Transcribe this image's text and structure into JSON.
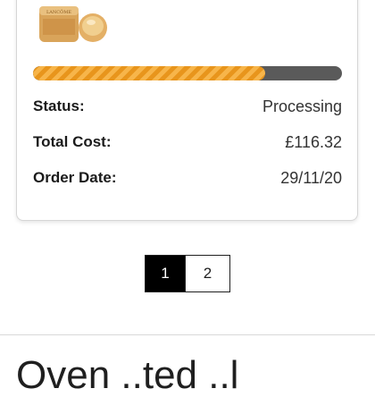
{
  "order": {
    "progress": 0.75,
    "rows": [
      {
        "label": "Status:",
        "value": "Processing"
      },
      {
        "label": "Total Cost:",
        "value": "£116.32"
      },
      {
        "label": "Order Date:",
        "value": "29/11/20"
      }
    ],
    "product_image": "product-cream-jar-image"
  },
  "pagination": {
    "pages": [
      "1",
      "2"
    ],
    "active": "1"
  },
  "next_section": {
    "heading_partial": "Oven  ..ted  ..l"
  },
  "colors": {
    "progress_fill": "#f0a024",
    "progress_track": "#5a5a5a",
    "active_page_bg": "#000000"
  }
}
